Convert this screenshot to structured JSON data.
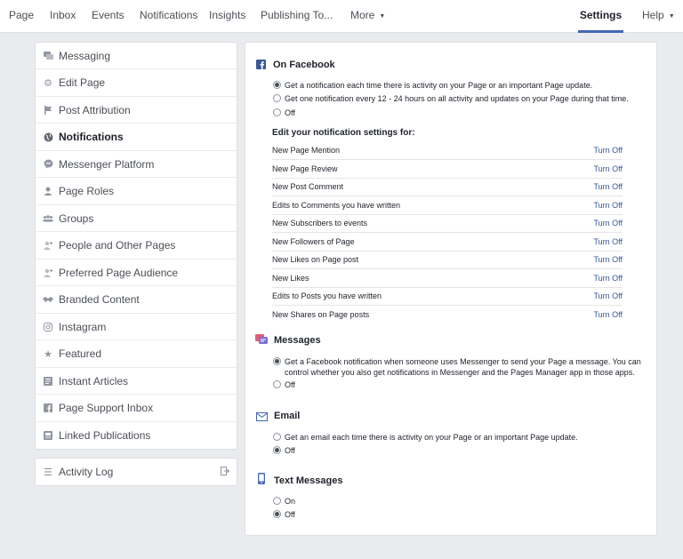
{
  "topnav": {
    "tabs": [
      {
        "label": "Page"
      },
      {
        "label": "Inbox"
      },
      {
        "label": "Events"
      },
      {
        "label": "Notifications"
      },
      {
        "label": "Insights"
      },
      {
        "label": "Publishing To..."
      },
      {
        "label": "More"
      },
      {
        "label": "Settings"
      },
      {
        "label": "Help"
      }
    ],
    "active_tab": "Settings"
  },
  "sidebar": {
    "items": [
      {
        "label": "Messaging",
        "icon": "chat-icon"
      },
      {
        "label": "Edit Page",
        "icon": "gear-icon"
      },
      {
        "label": "Post Attribution",
        "icon": "flag-icon"
      },
      {
        "label": "Notifications",
        "icon": "globe-icon",
        "active": true
      },
      {
        "label": "Messenger Platform",
        "icon": "messenger-icon"
      },
      {
        "label": "Page Roles",
        "icon": "person-icon"
      },
      {
        "label": "Groups",
        "icon": "group-icon"
      },
      {
        "label": "People and Other Pages",
        "icon": "person-plus-icon"
      },
      {
        "label": "Preferred Page Audience",
        "icon": "person-plus-icon"
      },
      {
        "label": "Branded Content",
        "icon": "handshake-icon"
      },
      {
        "label": "Instagram",
        "icon": "instagram-icon"
      },
      {
        "label": "Featured",
        "icon": "star-icon"
      },
      {
        "label": "Instant Articles",
        "icon": "article-icon"
      },
      {
        "label": "Page Support Inbox",
        "icon": "facebook-icon"
      },
      {
        "label": "Linked Publications",
        "icon": "publication-icon"
      }
    ],
    "activity_log": {
      "label": "Activity Log",
      "icon": "list-icon"
    }
  },
  "main": {
    "facebook": {
      "title": "On Facebook",
      "options": [
        {
          "label": "Get a notification each time there is activity on your Page or an important Page update.",
          "selected": true
        },
        {
          "label": "Get one notification every 12 - 24 hours on all activity and updates on your Page during that time.",
          "selected": false
        },
        {
          "label": "Off",
          "selected": false
        }
      ]
    },
    "edit_title": "Edit your notification settings for:",
    "notification_rows": [
      {
        "label": "New Page Mention",
        "action": "Turn Off"
      },
      {
        "label": "New Page Review",
        "action": "Turn Off"
      },
      {
        "label": "New Post Comment",
        "action": "Turn Off"
      },
      {
        "label": "Edits to Comments you have written",
        "action": "Turn Off"
      },
      {
        "label": "New Subscribers to events",
        "action": "Turn Off"
      },
      {
        "label": "New Followers of Page",
        "action": "Turn Off"
      },
      {
        "label": "New Likes on Page post",
        "action": "Turn Off"
      },
      {
        "label": "New Likes",
        "action": "Turn Off"
      },
      {
        "label": "Edits to Posts you have written",
        "action": "Turn Off"
      },
      {
        "label": "New Shares on Page posts",
        "action": "Turn Off"
      }
    ],
    "messages": {
      "title": "Messages",
      "options": [
        {
          "label": "Get a Facebook notification when someone uses Messenger to send your Page a message. You can control whether you also get notifications in Messenger and the Pages Manager app in those apps.",
          "selected": true
        },
        {
          "label": "Off",
          "selected": false
        }
      ]
    },
    "email": {
      "title": "Email",
      "options": [
        {
          "label": "Get an email each time there is activity on your Page or an important Page update.",
          "selected": false
        },
        {
          "label": "Off",
          "selected": true
        }
      ]
    },
    "text_messages": {
      "title": "Text Messages",
      "options": [
        {
          "label": "On",
          "selected": false
        },
        {
          "label": "Off",
          "selected": true
        }
      ]
    }
  },
  "colors": {
    "background": "#e9ebee",
    "link": "#365899",
    "accent": "#4267b2"
  }
}
